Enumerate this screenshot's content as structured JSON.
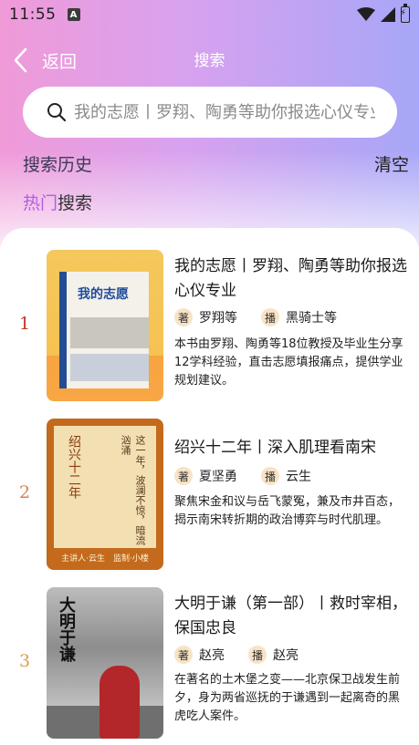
{
  "status_bar": {
    "time": "11:55",
    "notification_icon": "A"
  },
  "nav": {
    "back_label": "返回",
    "title": "搜索"
  },
  "search": {
    "placeholder": "我的志愿丨罗翔、陶勇等助你报选心仪专业"
  },
  "history": {
    "label": "搜索历史",
    "clear_label": "清空"
  },
  "hot": {
    "title_highlight": "热门",
    "title_rest": "搜索"
  },
  "items": [
    {
      "rank": "1",
      "rank_color": "#c0392b",
      "title": "我的志愿丨罗翔、陶勇等助你报选心仪专业",
      "author_tag": "著",
      "author": "罗翔等",
      "narrator_tag": "播",
      "narrator": "黑骑士等",
      "description": "本书由罗翔、陶勇等18位教授及毕业生分享12学科经验，直击志愿填报痛点，提供学业规划建议。",
      "cover_text": "我的志愿"
    },
    {
      "rank": "2",
      "rank_color": "#d9824a",
      "title": "绍兴十二年丨深入肌理看南宋",
      "author_tag": "著",
      "author": "夏坚勇",
      "narrator_tag": "播",
      "narrator": "云生",
      "description": "聚焦宋金和议与岳飞蒙冤，兼及市井百态，揭示南宋转折期的政治博弈与时代肌理。",
      "cover_text": "绍兴十二年",
      "cover_subtext": "这一年，波澜不惊，暗流汹涌",
      "cover_footer": "主讲人·云生　监制·小楼"
    },
    {
      "rank": "3",
      "rank_color": "#d9a04a",
      "title": "大明于谦（第一部）丨救时宰相，保国忠良",
      "author_tag": "著",
      "author": "赵亮",
      "narrator_tag": "播",
      "narrator": "赵亮",
      "description": "在著名的土木堡之变——北京保卫战发生前夕，身为两省巡抚的于谦遇到一起离奇的黑虎吃人案件。",
      "cover_text": "大明于谦"
    }
  ]
}
